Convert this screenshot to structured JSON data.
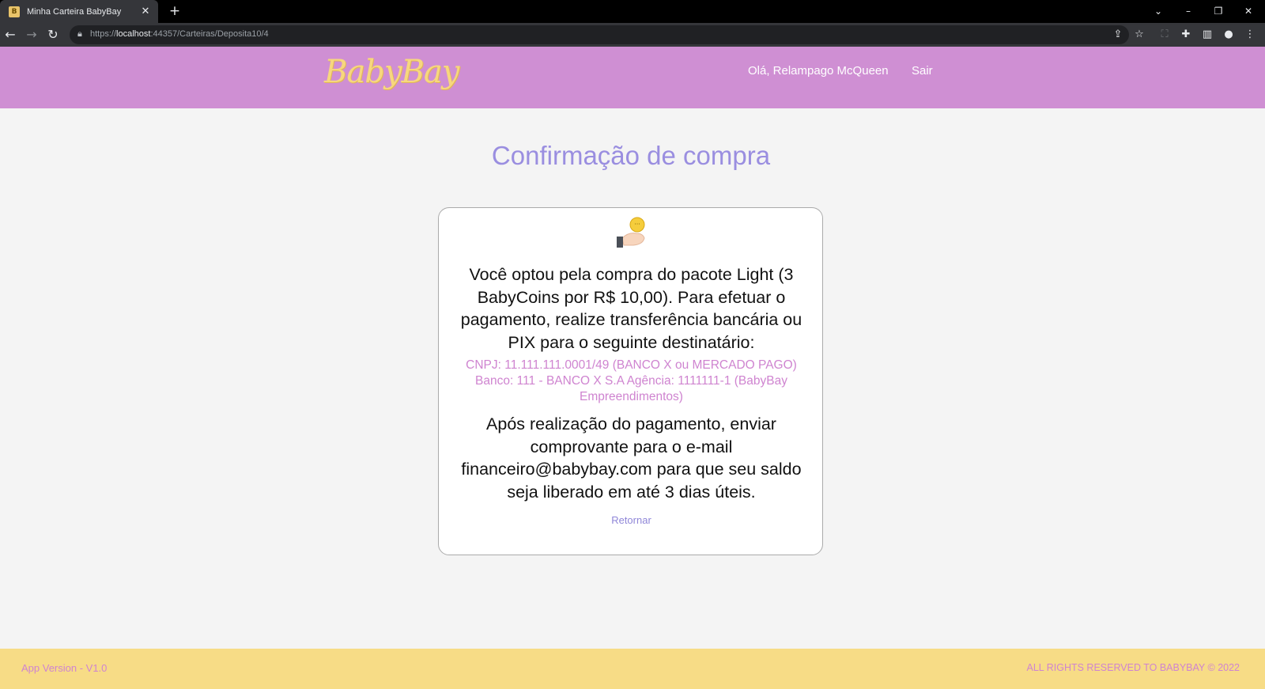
{
  "browser": {
    "tab_title": "Minha Carteira BabyBay",
    "tab_favicon_letter": "B",
    "url_scheme": "https://",
    "url_host": "localhost",
    "url_path": ":44357/Carteiras/Deposita10/4"
  },
  "header": {
    "logo": "BabyBay",
    "greeting": "Olá, Relampago McQueen",
    "logout_label": "Sair"
  },
  "main": {
    "title": "Confirmação de compra",
    "intro": "Você optou pela compra do pacote Light (3 BabyCoins por R$ 10,00). Para efetuar o pagamento, realize transferência bancária ou PIX para o seguinte destinatário:",
    "bank_line1": "CNPJ: 11.111.111.0001/49 (BANCO X ou MERCADO PAGO)",
    "bank_line2": "Banco: 111 - BANCO X S.A Agência: 1111111-1 (BabyBay Empreendimentos)",
    "outro": "Após realização do pagamento, enviar comprovante para o e-mail financeiro@babybay.com para que seu saldo seja liberado em até 3 dias úteis.",
    "return_label": "Retornar"
  },
  "footer": {
    "version": "App Version - V1.0",
    "rights": "ALL RIGHTS RESERVED TO BABYBAY © 2022"
  },
  "colors": {
    "header_bg": "#cf8fd3",
    "logo": "#f7d77e",
    "title": "#9a8ee0",
    "bank_text": "#cf84d0",
    "footer_bg": "#f7dc86"
  }
}
